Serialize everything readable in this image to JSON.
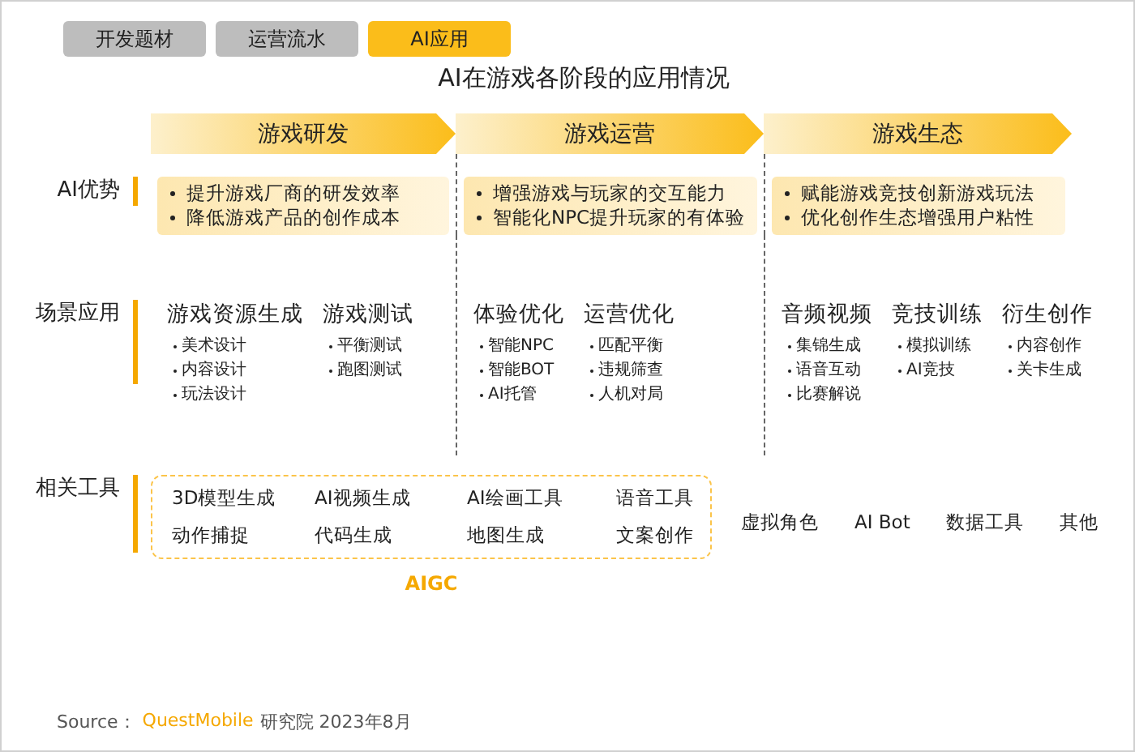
{
  "tabs": [
    {
      "label": "开发题材",
      "selected": false
    },
    {
      "label": "运营流水",
      "selected": false
    },
    {
      "label": "AI应用",
      "selected": true
    }
  ],
  "title": "AI在游戏各阶段的应用情况",
  "row_labels": {
    "advantages": "AI优势",
    "scenarios": "场景应用",
    "tools": "相关工具"
  },
  "stages": [
    {
      "name": "游戏研发",
      "advantages": [
        "提升游戏厂商的研发效率",
        "降低游戏产品的创作成本"
      ],
      "scenarios": [
        {
          "name": "游戏资源生成",
          "items": [
            "美术设计",
            "内容设计",
            "玩法设计"
          ]
        },
        {
          "name": "游戏测试",
          "items": [
            "平衡测试",
            "跑图测试"
          ]
        }
      ]
    },
    {
      "name": "游戏运营",
      "advantages": [
        "增强游戏与玩家的交互能力",
        "智能化NPC提升玩家的有体验"
      ],
      "scenarios": [
        {
          "name": "体验优化",
          "items": [
            "智能NPC",
            "智能BOT",
            "AI托管"
          ]
        },
        {
          "name": "运营优化",
          "items": [
            "匹配平衡",
            "违规筛查",
            "人机对局"
          ]
        }
      ]
    },
    {
      "name": "游戏生态",
      "advantages": [
        "赋能游戏竞技创新游戏玩法",
        "优化创作生态增强用户粘性"
      ],
      "scenarios": [
        {
          "name": "音频视频",
          "items": [
            "集锦生成",
            "语音互动",
            "比赛解说"
          ]
        },
        {
          "name": "竞技训练",
          "items": [
            "模拟训练",
            "AI竞技"
          ]
        },
        {
          "name": "衍生创作",
          "items": [
            "内容创作",
            "关卡生成"
          ]
        }
      ]
    }
  ],
  "tools": {
    "aigc": [
      "3D模型生成",
      "AI视频生成",
      "AI绘画工具",
      "语音工具",
      "动作捕捉",
      "代码生成",
      "地图生成",
      "文案创作"
    ],
    "aigc_label": "AIGC",
    "others": [
      "虚拟角色",
      "AI Bot",
      "数据工具",
      "其他"
    ]
  },
  "source": {
    "label": "Source：",
    "brand": "QuestMobile",
    "text": "研究院 2023年8月"
  }
}
